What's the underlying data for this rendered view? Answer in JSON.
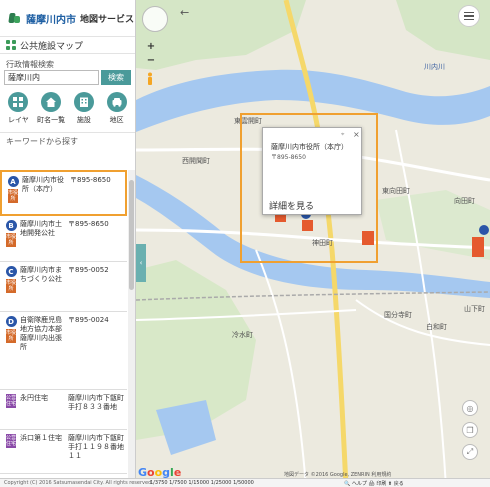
{
  "header": {
    "title": "薩摩川内市",
    "subtitle": "地図サービス"
  },
  "map_title": "公共施設マップ",
  "search": {
    "label": "行政情報検索",
    "value": "薩摩川内",
    "button": "検索"
  },
  "tools": [
    {
      "label": "レイヤ",
      "icon": "layers-icon"
    },
    {
      "label": "町名一覧",
      "icon": "home-icon"
    },
    {
      "label": "施設",
      "icon": "building-icon"
    },
    {
      "label": "地区",
      "icon": "car-icon"
    }
  ],
  "keyword_label": "キーワードから探す",
  "results": [
    {
      "pin": "A",
      "tag": "市役所",
      "tag_color": "#d46a2a",
      "name": "薩摩川内市役所（本庁）",
      "addr": "〒895-8650"
    },
    {
      "pin": "B",
      "tag": "市役所",
      "tag_color": "#d46a2a",
      "name": "薩摩川内市土地開発公社",
      "addr": "〒895-8650"
    },
    {
      "pin": "C",
      "tag": "市役所",
      "tag_color": "#d46a2a",
      "name": "薩摩川内市まちづくり公社",
      "addr": "〒895-0052"
    },
    {
      "pin": "D",
      "tag": "市役所",
      "tag_color": "#d46a2a",
      "name": "自衛隊鹿児島地方協力本部薩摩川内出張所",
      "addr": "〒895-0024"
    },
    {
      "pin": "",
      "tag": "公営住宅",
      "tag_color": "#8a4aa8",
      "name": "永円住宅",
      "addr": "薩摩川内市下甑町手打８３３番地"
    },
    {
      "pin": "",
      "tag": "公営住宅",
      "tag_color": "#8a4aa8",
      "name": "浜口第１住宅",
      "addr": "薩摩川内市下甑町手打１１９８番地１１"
    }
  ],
  "popup": {
    "title": "薩摩川内市役所（本庁）",
    "zip": "〒895-8650",
    "detail": "詳細を見る",
    "close": "×"
  },
  "map_labels": [
    {
      "text": "川内川",
      "cls": "blue",
      "pos": "top-right"
    },
    {
      "text": "東雲開町",
      "cls": "",
      "pos": ""
    },
    {
      "text": "西開聞町",
      "cls": "",
      "pos": ""
    },
    {
      "text": "神田町",
      "cls": "",
      "pos": ""
    },
    {
      "text": "東向田町",
      "cls": "",
      "pos": ""
    },
    {
      "text": "向田町",
      "cls": "",
      "pos": ""
    },
    {
      "text": "白和町",
      "cls": "",
      "pos": ""
    },
    {
      "text": "冷水町",
      "cls": "",
      "pos": ""
    },
    {
      "text": "国分寺町",
      "cls": "",
      "pos": ""
    },
    {
      "text": "山下町",
      "cls": "",
      "pos": ""
    }
  ],
  "google": "Google",
  "attribution": "地図データ ©2016 Google, ZENRIN  利用規約",
  "bottombar": {
    "copyright": "Copyright (C) 2016 Satsumasendai City. All rights reserved.",
    "scale": "1/3750  1/7500  1/15000  1/25000  1/50000",
    "links": "🔍 ヘルプ  🖨 印刷  ⬆ 戻る"
  },
  "colors": {
    "accent": "#4a9a9a",
    "highlight": "#f0a030",
    "pin": "#2a56a8",
    "water": "#a5c8f0",
    "road_major": "#f5d86a"
  }
}
